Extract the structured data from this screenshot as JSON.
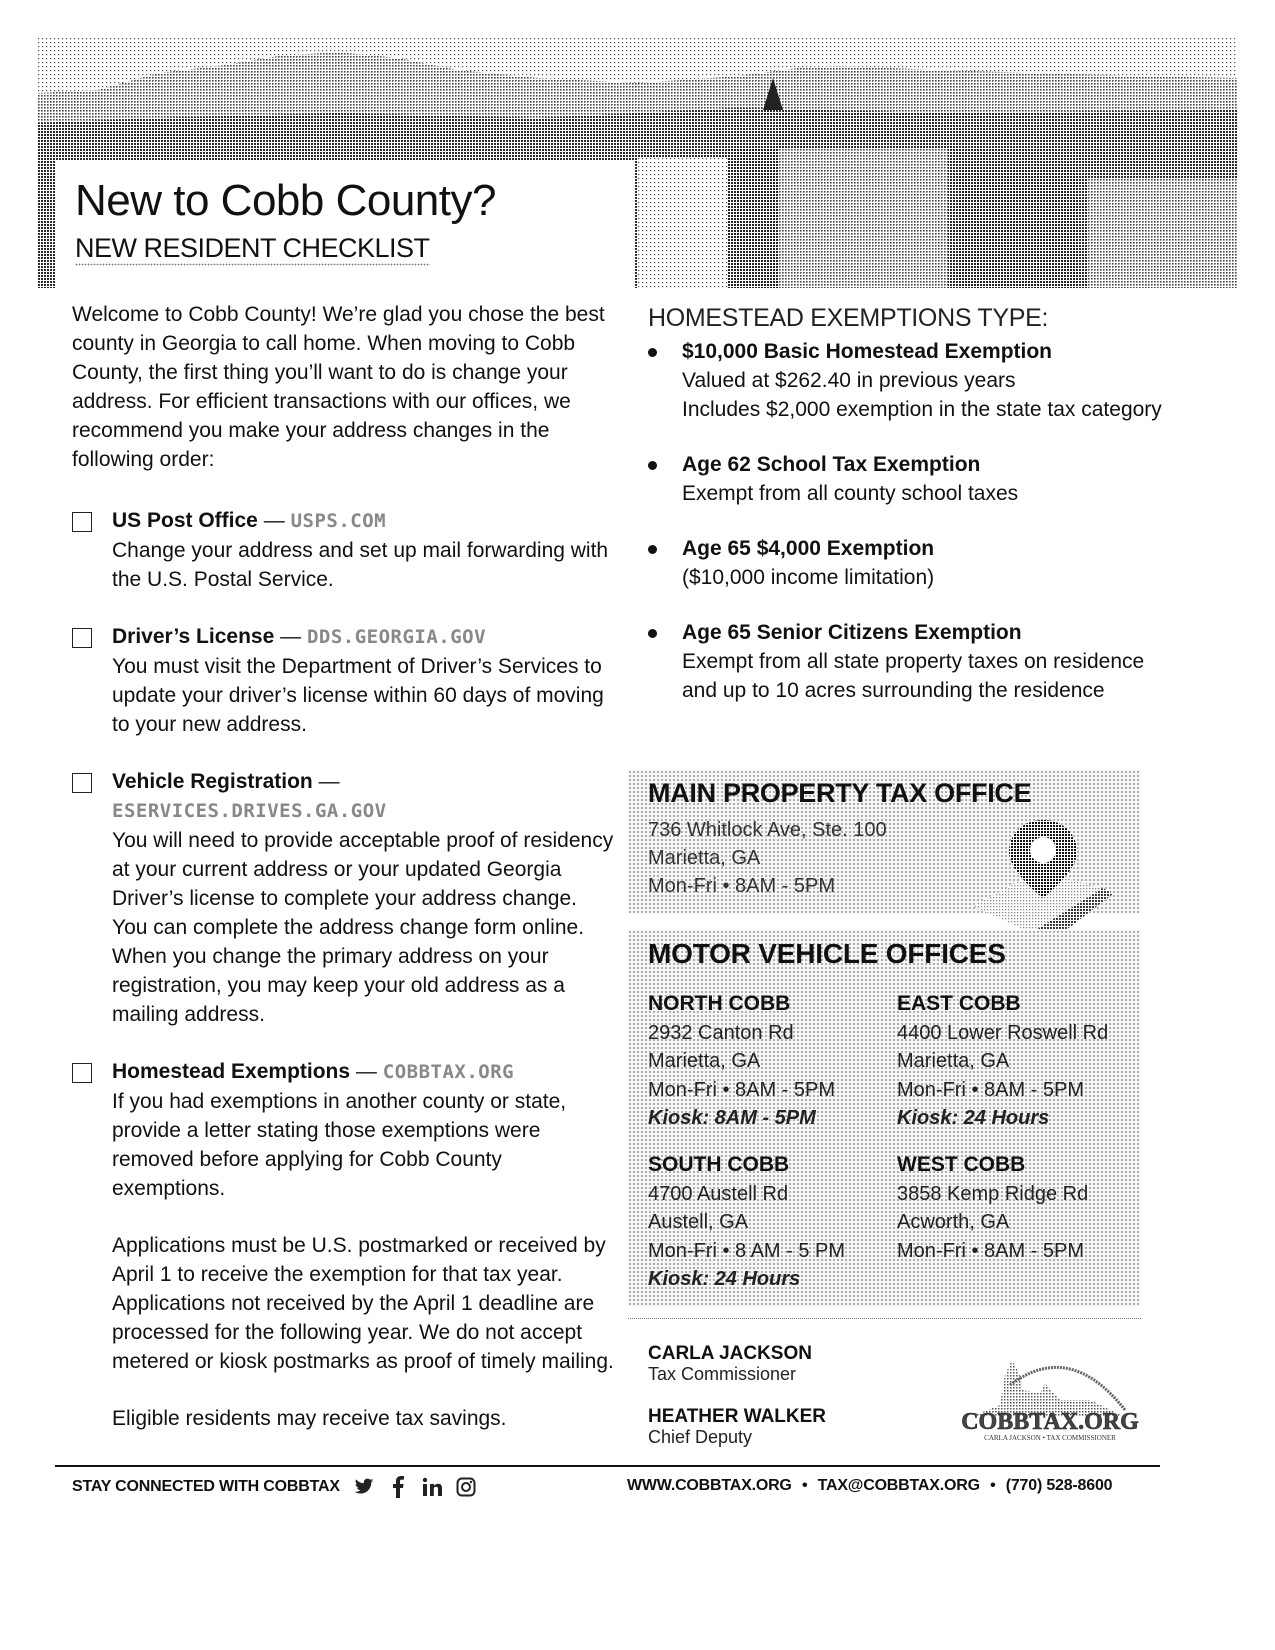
{
  "header": {
    "title": "New to Cobb County?",
    "subtitle": "NEW RESIDENT CHECKLIST",
    "hero_image": "halftone photo of Marietta / Cobb County with Kennesaw Mountain"
  },
  "intro": "Welcome to Cobb County! We’re glad you chose the best county in Georgia to call home. When moving to Cobb County, the first thing you’ll want to do is change your address. For efficient transactions with our offices, we recommend you make your address changes in the following order:",
  "checklist": [
    {
      "title": "US Post Office",
      "dash": "—",
      "link": "USPS.COM",
      "checked": false,
      "description": "Change your address and set up mail forwarding with the U.S. Postal Service."
    },
    {
      "title": "Driver’s License",
      "dash": "—",
      "link": "DDS.GEORGIA.GOV",
      "checked": false,
      "description": "You must visit the Department of Driver’s Services to update your driver’s license within 60 days of moving to your new address."
    },
    {
      "title": "Vehicle Registration",
      "dash": "—",
      "link": "ESERVICES.DRIVES.GA.GOV",
      "checked": false,
      "description": "You will need to provide acceptable proof of residency at your current address or your updated Georgia Driver’s license to complete your address change. You can complete the address change form online. When you change the primary address on your registration, you may keep your old address as a mailing address."
    },
    {
      "title": "Homestead Exemptions",
      "dash": "—",
      "link": "COBBTAX.ORG",
      "checked": false,
      "description": "If you had exemptions in another county or state, provide a letter stating those exemptions were removed before applying for Cobb County exemptions.",
      "paragraphs": [
        "Applications must be U.S. postmarked or received by April 1 to receive the exemption for that tax year. Applications not received by the April 1 deadline are processed for the following year. We do not accept metered or kiosk postmarks as proof of timely mailing.",
        "Eligible residents may receive tax savings."
      ]
    }
  ],
  "homestead": {
    "heading": "HOMESTEAD EXEMPTIONS TYPE:",
    "items": [
      {
        "title": "$10,000 Basic Homestead Exemption",
        "lines": [
          "Valued at $262.40 in previous years",
          "Includes $2,000 exemption in the state tax category"
        ]
      },
      {
        "title": "Age 62 School Tax Exemption",
        "lines": [
          "Exempt from all county school taxes"
        ]
      },
      {
        "title": "Age 65 $4,000 Exemption",
        "lines": [
          "($10,000 income limitation)"
        ]
      },
      {
        "title": "Age 65 Senior Citizens Exemption",
        "lines": [
          "Exempt from all state property taxes on residence and up to 10 acres surrounding the residence"
        ]
      }
    ]
  },
  "main_office": {
    "heading": "MAIN PROPERTY TAX OFFICE",
    "address": "736 Whitlock Ave, Ste. 100",
    "city": "Marietta, GA",
    "hours": "Mon-Fri • 8AM - 5PM",
    "icon": "map-pin-icon"
  },
  "motor_vehicle": {
    "heading": "MOTOR VEHICLE OFFICES",
    "offices": [
      {
        "name": "NORTH COBB",
        "address": "2932 Canton Rd",
        "city": "Marietta, GA",
        "hours": "Mon-Fri • 8AM - 5PM",
        "kiosk": "Kiosk: 8AM - 5PM"
      },
      {
        "name": "EAST COBB",
        "address": "4400 Lower Roswell Rd",
        "city": "Marietta, GA",
        "hours": "Mon-Fri • 8AM - 5PM",
        "kiosk": "Kiosk: 24 Hours"
      },
      {
        "name": "SOUTH COBB",
        "address": "4700 Austell Rd",
        "city": "Austell, GA",
        "hours": "Mon-Fri • 8 AM - 5 PM",
        "kiosk": "Kiosk: 24 Hours"
      },
      {
        "name": "WEST COBB",
        "address": "3858 Kemp Ridge Rd",
        "city": "Acworth, GA",
        "hours": "Mon-Fri • 8AM - 5PM",
        "kiosk": ""
      }
    ]
  },
  "officials": [
    {
      "name": "CARLA JACKSON",
      "title": "Tax Commissioner"
    },
    {
      "name": "HEATHER WALKER",
      "title": "Chief Deputy"
    }
  ],
  "logo": {
    "text": "COBBTAX.ORG",
    "tagline": "CARLA JACKSON • TAX COMMISSIONER"
  },
  "footer": {
    "stay_connected": "STAY CONNECTED WITH COBBTAX",
    "social_icons": [
      "twitter-icon",
      "facebook-icon",
      "linkedin-icon",
      "instagram-icon"
    ],
    "website": "WWW.COBBTAX.ORG",
    "email": "TAX@COBBTAX.ORG",
    "phone": "(770) 528-8600",
    "separator": "•"
  }
}
